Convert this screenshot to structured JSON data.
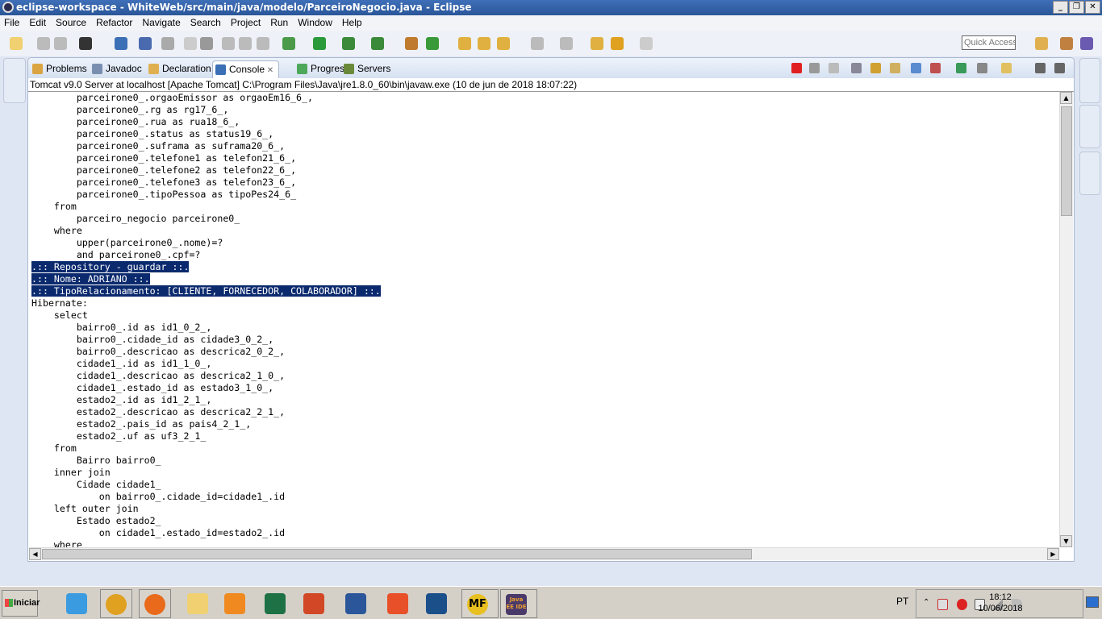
{
  "window": {
    "title": "eclipse-workspace - WhiteWeb/src/main/java/modelo/ParceiroNegocio.java - Eclipse"
  },
  "menu": [
    "File",
    "Edit",
    "Source",
    "Refactor",
    "Navigate",
    "Search",
    "Project",
    "Run",
    "Window",
    "Help"
  ],
  "quick_access": {
    "placeholder": "Quick Access"
  },
  "tabs": [
    {
      "label": "Problems",
      "icon": "problems-icon",
      "color": "#d9a441"
    },
    {
      "label": "Javadoc",
      "icon": "at-icon",
      "color": "#7a8fb0"
    },
    {
      "label": "Declaration",
      "icon": "declaration-icon",
      "color": "#e0b050"
    },
    {
      "label": "Console",
      "icon": "console-icon",
      "color": "#3b6fb6",
      "active": true
    },
    {
      "label": "Progress",
      "icon": "progress-icon",
      "color": "#4da85a"
    },
    {
      "label": "Servers",
      "icon": "servers-icon",
      "color": "#6a8a3a"
    }
  ],
  "console": {
    "header": "Tomcat v9.0 Server at localhost [Apache Tomcat] C:\\Program Files\\Java\\jre1.8.0_60\\bin\\javaw.exe (10 de jun de 2018 18:07:22)",
    "lines": [
      {
        "text": "        parceirone0_.orgaoEmissor as orgaoEm16_6_,"
      },
      {
        "text": "        parceirone0_.rg as rg17_6_,"
      },
      {
        "text": "        parceirone0_.rua as rua18_6_,"
      },
      {
        "text": "        parceirone0_.status as status19_6_,"
      },
      {
        "text": "        parceirone0_.suframa as suframa20_6_,"
      },
      {
        "text": "        parceirone0_.telefone1 as telefon21_6_,"
      },
      {
        "text": "        parceirone0_.telefone2 as telefon22_6_,"
      },
      {
        "text": "        parceirone0_.telefone3 as telefon23_6_,"
      },
      {
        "text": "        parceirone0_.tipoPessoa as tipoPes24_6_"
      },
      {
        "text": "    from"
      },
      {
        "text": "        parceiro_negocio parceirone0_"
      },
      {
        "text": "    where"
      },
      {
        "text": "        upper(parceirone0_.nome)=?"
      },
      {
        "text": "        and parceirone0_.cpf=?"
      },
      {
        "text": ".:: Repository - guardar ::.",
        "selected": true
      },
      {
        "text": ".:: Nome: ADRIANO ::.",
        "selected": true
      },
      {
        "text": ".:: TipoRelacionamento: [CLIENTE, FORNECEDOR, COLABORADOR] ::.",
        "selected": true
      },
      {
        "text": "Hibernate: "
      },
      {
        "text": "    select"
      },
      {
        "text": "        bairro0_.id as id1_0_2_,"
      },
      {
        "text": "        bairro0_.cidade_id as cidade3_0_2_,"
      },
      {
        "text": "        bairro0_.descricao as descrica2_0_2_,"
      },
      {
        "text": "        cidade1_.id as id1_1_0_,"
      },
      {
        "text": "        cidade1_.descricao as descrica2_1_0_,"
      },
      {
        "text": "        cidade1_.estado_id as estado3_1_0_,"
      },
      {
        "text": "        estado2_.id as id1_2_1_,"
      },
      {
        "text": "        estado2_.descricao as descrica2_2_1_,"
      },
      {
        "text": "        estado2_.pais_id as pais4_2_1_,"
      },
      {
        "text": "        estado2_.uf as uf3_2_1_"
      },
      {
        "text": "    from"
      },
      {
        "text": "        Bairro bairro0_"
      },
      {
        "text": "    inner join"
      },
      {
        "text": "        Cidade cidade1_"
      },
      {
        "text": "            on bairro0_.cidade_id=cidade1_.id"
      },
      {
        "text": "    left outer join"
      },
      {
        "text": "        Estado estado2_"
      },
      {
        "text": "            on cidade1_.estado_id=estado2_.id"
      },
      {
        "text": "    where"
      }
    ]
  },
  "taskbar": {
    "start_label": "Iniciar",
    "apps": [
      {
        "name": "internet-explorer",
        "color": "#3a9be0"
      },
      {
        "name": "chrome",
        "color": "#e0a020"
      },
      {
        "name": "firefox",
        "color": "#e86a1a"
      },
      {
        "name": "file-explorer",
        "color": "#f0d070"
      },
      {
        "name": "media-player",
        "color": "#f08a20"
      },
      {
        "name": "excel",
        "color": "#1e7145"
      },
      {
        "name": "powerpoint",
        "color": "#d24726"
      },
      {
        "name": "word",
        "color": "#2b579a"
      },
      {
        "name": "acrobat",
        "color": "#e8502a"
      },
      {
        "name": "virtualbox",
        "color": "#1b4f8a"
      },
      {
        "name": "mf",
        "color": "#e8c020",
        "label": "MF"
      },
      {
        "name": "eclipse-javaee",
        "color": "#4a3a6a",
        "label": "Java EE IDE"
      }
    ],
    "language": "PT",
    "time": "18:12",
    "date": "10/06/2018"
  }
}
